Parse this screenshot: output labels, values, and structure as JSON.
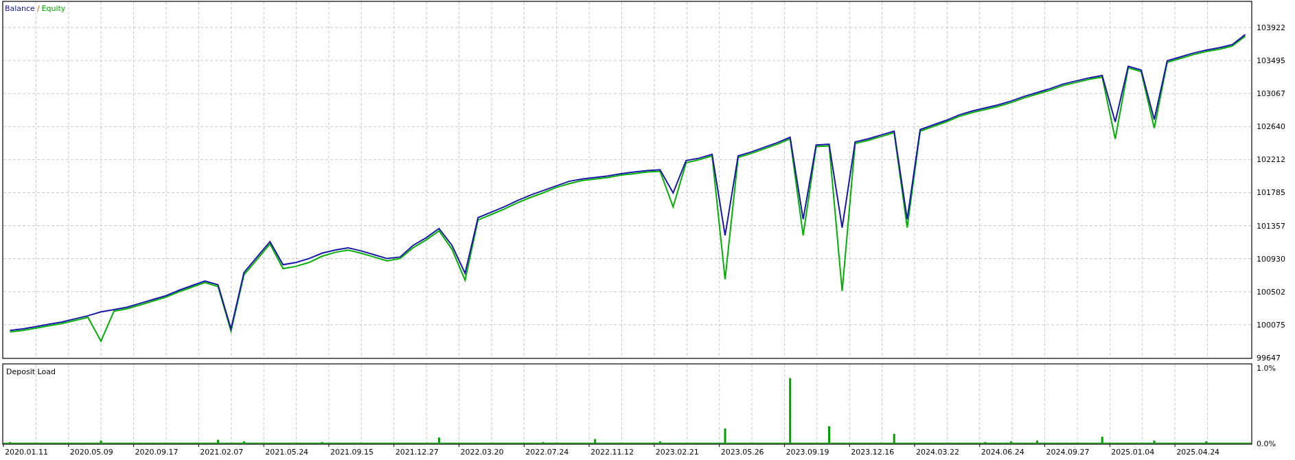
{
  "balance_panel": {
    "legend_separator": "/",
    "chart_data": {
      "type": "line",
      "grid": true,
      "ylim": [
        99647,
        104251
      ],
      "yticks": [
        {
          "value": 99647,
          "label": "99647"
        },
        {
          "value": 100075,
          "label": "100075"
        },
        {
          "value": 100502,
          "label": "100502"
        },
        {
          "value": 100930,
          "label": "100930"
        },
        {
          "value": 101357,
          "label": "101357"
        },
        {
          "value": 101785,
          "label": "101785"
        },
        {
          "value": 102212,
          "label": "102212"
        },
        {
          "value": 102640,
          "label": "102640"
        },
        {
          "value": 103067,
          "label": "103067"
        },
        {
          "value": 103495,
          "label": "103495"
        },
        {
          "value": 103922,
          "label": "103922"
        }
      ],
      "categories": [
        null,
        null,
        null,
        null,
        null,
        null,
        null,
        null,
        null,
        null,
        null,
        null,
        null,
        null,
        null,
        null,
        null,
        null,
        null,
        null,
        null,
        null,
        null,
        null,
        null,
        null,
        null,
        null,
        null,
        null,
        null,
        null,
        null,
        null,
        null,
        null,
        null,
        null,
        null,
        null,
        null,
        null,
        null,
        null,
        null,
        null,
        null,
        null,
        null,
        null,
        null,
        null,
        null,
        null,
        null,
        null,
        null,
        null,
        null,
        null,
        null,
        null,
        null,
        null,
        null,
        null,
        null,
        null,
        null,
        null,
        null,
        null,
        null,
        null,
        null,
        null,
        null,
        null,
        null,
        null,
        null,
        null,
        null,
        null,
        null,
        null,
        null,
        null,
        null,
        null,
        null,
        null,
        null,
        null,
        null,
        null
      ],
      "series": [
        {
          "name": "Balance",
          "color": "#1616a8",
          "values": [
            100000,
            100020,
            100050,
            100080,
            100110,
            100150,
            100190,
            100240,
            100270,
            100300,
            100350,
            100400,
            100450,
            100520,
            100580,
            100640,
            100590,
            100020,
            100750,
            100950,
            101150,
            100850,
            100880,
            100930,
            101000,
            101040,
            101070,
            101030,
            100980,
            100930,
            100950,
            101100,
            101200,
            101320,
            101100,
            100740,
            101460,
            101530,
            101600,
            101680,
            101750,
            101810,
            101870,
            101930,
            101960,
            101980,
            102000,
            102030,
            102050,
            102070,
            102080,
            101780,
            102200,
            102230,
            102280,
            101230,
            102260,
            102310,
            102370,
            102430,
            102500,
            101440,
            102400,
            102410,
            101330,
            102440,
            102480,
            102530,
            102580,
            101440,
            102600,
            102660,
            102720,
            102790,
            102840,
            102880,
            102920,
            102970,
            103030,
            103080,
            103130,
            103190,
            103230,
            103270,
            103300,
            102700,
            103420,
            103370,
            102730,
            103490,
            103540,
            103590,
            103630,
            103660,
            103700,
            103830
          ]
        },
        {
          "name": "Equity",
          "color": "#00b000",
          "values": [
            99980,
            100000,
            100030,
            100060,
            100090,
            100130,
            100170,
            99860,
            100250,
            100280,
            100330,
            100380,
            100430,
            100500,
            100560,
            100620,
            100570,
            99990,
            100720,
            100920,
            101120,
            100800,
            100830,
            100880,
            100960,
            101010,
            101040,
            101000,
            100950,
            100900,
            100930,
            101070,
            101170,
            101290,
            101050,
            100650,
            101430,
            101500,
            101570,
            101650,
            101720,
            101780,
            101850,
            101900,
            101940,
            101960,
            101980,
            102010,
            102030,
            102050,
            102060,
            101600,
            102170,
            102210,
            102260,
            100660,
            102240,
            102290,
            102350,
            102410,
            102480,
            101230,
            102380,
            102390,
            100510,
            102420,
            102460,
            102510,
            102560,
            101330,
            102580,
            102640,
            102700,
            102770,
            102820,
            102860,
            102900,
            102950,
            103010,
            103060,
            103110,
            103170,
            103210,
            103250,
            103280,
            102480,
            103400,
            103350,
            102620,
            103470,
            103520,
            103570,
            103610,
            103640,
            103680,
            103810
          ]
        }
      ]
    }
  },
  "deposit_panel": {
    "chart_data": {
      "type": "bar",
      "grid": true,
      "title": "Deposit Load",
      "ylim": [
        0,
        1.05
      ],
      "yticks": [
        {
          "value": 0,
          "label": "0.0%"
        },
        {
          "value": 1,
          "label": "1.0%"
        }
      ],
      "categories": [
        null,
        null,
        null,
        null,
        null,
        null,
        null,
        null,
        null,
        null,
        null,
        null,
        null,
        null,
        null,
        null,
        null,
        null,
        null,
        null,
        null,
        null,
        null,
        null,
        null,
        null,
        null,
        null,
        null,
        null,
        null,
        null,
        null,
        null,
        null,
        null,
        null,
        null,
        null,
        null,
        null,
        null,
        null,
        null,
        null,
        null,
        null,
        null,
        null,
        null,
        null,
        null,
        null,
        null,
        null,
        null,
        null,
        null,
        null,
        null,
        null,
        null,
        null,
        null,
        null,
        null,
        null,
        null,
        null,
        null,
        null,
        null,
        null,
        null,
        null,
        null,
        null,
        null,
        null,
        null,
        null,
        null,
        null,
        null,
        null,
        null,
        null,
        null,
        null,
        null,
        null,
        null,
        null,
        null,
        null,
        null
      ],
      "values": [
        0.02,
        0,
        0,
        0,
        0,
        0,
        0,
        0.04,
        0,
        0,
        0,
        0,
        0,
        0,
        0,
        0,
        0.05,
        0,
        0.03,
        0,
        0,
        0,
        0,
        0,
        0.02,
        0,
        0,
        0,
        0,
        0,
        0,
        0,
        0,
        0.08,
        0,
        0,
        0,
        0,
        0,
        0,
        0,
        0.02,
        0,
        0,
        0,
        0.06,
        0,
        0,
        0,
        0,
        0.03,
        0,
        0,
        0,
        0,
        0.2,
        0,
        0,
        0,
        0,
        0.87,
        0,
        0,
        0.23,
        0,
        0,
        0,
        0,
        0.13,
        0,
        0,
        0,
        0,
        0,
        0,
        0.02,
        0,
        0.03,
        0,
        0.04,
        0,
        0,
        0,
        0,
        0.09,
        0,
        0,
        0,
        0.04,
        0,
        0,
        0,
        0.03,
        0,
        0,
        0
      ]
    }
  },
  "time_axis": [
    "2020.01.11",
    "2020.05.09",
    "2020.09.17",
    "2021.02.07",
    "2021.05.24",
    "2021.09.15",
    "2021.12.27",
    "2022.03.20",
    "2022.07.24",
    "2022.11.12",
    "2023.02.21",
    "2023.05.26",
    "2023.09.19",
    "2023.12.16",
    "2024.03.22",
    "2024.06.24",
    "2024.09.27",
    "2025.01.04",
    "2025.04.24"
  ]
}
